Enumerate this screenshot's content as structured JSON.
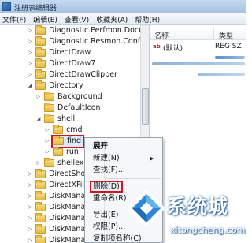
{
  "window": {
    "title": "注册表编辑器"
  },
  "menubar": [
    "文件(F)",
    "编辑(E)",
    "查看(V)",
    "收藏夹(A)",
    "帮助(H)"
  ],
  "tree": {
    "rows": [
      {
        "label": "Diagnostic.Perfmon.Document",
        "expander": "▷"
      },
      {
        "label": "Diagnostic.Resmon.Config",
        "expander": "▷"
      },
      {
        "label": "DirectDraw",
        "expander": "▷"
      },
      {
        "label": "DirectDraw7",
        "expander": "▷"
      },
      {
        "label": "DirectDrawClipper",
        "expander": "▷"
      },
      {
        "label": "Directory",
        "expander": "◢"
      },
      {
        "label": "Background",
        "expander": "▷"
      },
      {
        "label": "DefaultIcon",
        "expander": ""
      },
      {
        "label": "shell",
        "expander": "◢"
      },
      {
        "label": "cmd",
        "expander": "▷"
      },
      {
        "label": "find",
        "expander": "▷"
      },
      {
        "label": "run",
        "expander": "▷"
      },
      {
        "label": "shellex",
        "expander": "▷"
      },
      {
        "label": "DirectShow",
        "expander": "▷"
      },
      {
        "label": "DirectXFile",
        "expander": "▷"
      },
      {
        "label": "DiskManagement",
        "expander": "▷"
      },
      {
        "label": "DiskManagement",
        "expander": "▷"
      },
      {
        "label": "DiskManagement",
        "expander": "▷"
      },
      {
        "label": "DiskManagement",
        "expander": "▷"
      },
      {
        "label": "DiskManagement",
        "expander": "▷"
      }
    ]
  },
  "list": {
    "headers": {
      "name": "名称",
      "type": "类型"
    },
    "rows": [
      {
        "icon": "ab",
        "name": "(默认)",
        "type": "REG SZ"
      }
    ]
  },
  "context_menu": {
    "items": [
      {
        "label": "展开",
        "submenu": false
      },
      {
        "label": "新建(N)",
        "submenu": true
      },
      {
        "label": "查找(F)...",
        "submenu": false
      },
      {
        "label": "删除(D)",
        "submenu": false
      },
      {
        "label": "重命名(R)",
        "submenu": false
      },
      {
        "label": "导出(E)",
        "submenu": false
      },
      {
        "label": "权限(P)...",
        "submenu": false
      },
      {
        "label": "复制项名称(C)",
        "submenu": false
      }
    ]
  },
  "watermark": {
    "brand": "系统城",
    "domain": "xitongcheng.com"
  },
  "colors": {
    "highlight_box": "#d3141f",
    "folder": "#e6b93f",
    "watermark_blue": "#1d5a98"
  }
}
